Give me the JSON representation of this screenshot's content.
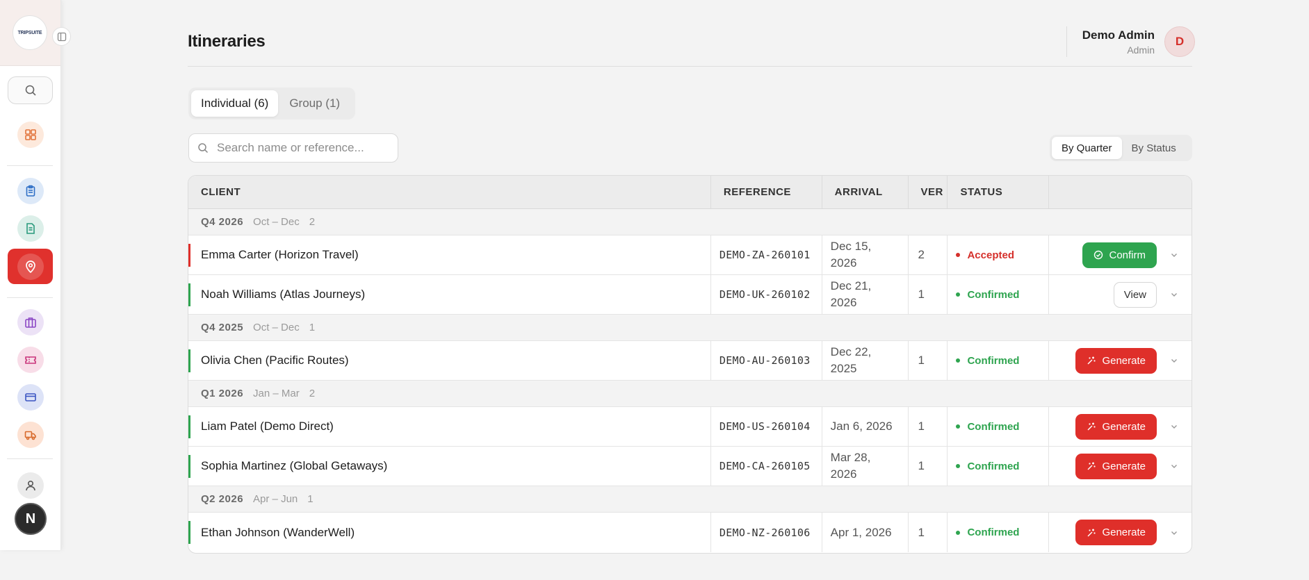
{
  "app": {
    "logo_text": "TRIPSUITE"
  },
  "header": {
    "title": "Itineraries",
    "user_name": "Demo Admin",
    "user_role": "Admin",
    "user_initial": "D"
  },
  "sidebar": {
    "user_initial": "N"
  },
  "tabs": [
    {
      "label": "Individual (6)"
    },
    {
      "label": "Group (1)"
    }
  ],
  "search": {
    "placeholder": "Search name or reference..."
  },
  "view_toggle": [
    {
      "label": "By Quarter"
    },
    {
      "label": "By Status"
    }
  ],
  "table": {
    "columns": [
      "CLIENT",
      "REFERENCE",
      "ARRIVAL",
      "VER",
      "STATUS"
    ],
    "groups": [
      {
        "quarter": "Q4 2026",
        "range": "Oct – Dec",
        "count": "2",
        "rows": [
          {
            "client": "Emma Carter (Horizon Travel)",
            "reference": "DEMO-ZA-260101",
            "arrival_line1": "Dec 15,",
            "arrival_line2": "2026",
            "ver": "2",
            "status": "Accepted",
            "action": "Confirm"
          },
          {
            "client": "Noah Williams (Atlas Journeys)",
            "reference": "DEMO-UK-260102",
            "arrival_line1": "Dec 21,",
            "arrival_line2": "2026",
            "ver": "1",
            "status": "Confirmed",
            "action": "View"
          }
        ]
      },
      {
        "quarter": "Q4 2025",
        "range": "Oct – Dec",
        "count": "1",
        "rows": [
          {
            "client": "Olivia Chen (Pacific Routes)",
            "reference": "DEMO-AU-260103",
            "arrival_line1": "Dec 22,",
            "arrival_line2": "2025",
            "ver": "1",
            "status": "Confirmed",
            "action": "Generate"
          }
        ]
      },
      {
        "quarter": "Q1 2026",
        "range": "Jan – Mar",
        "count": "2",
        "rows": [
          {
            "client": "Liam Patel (Demo Direct)",
            "reference": "DEMO-US-260104",
            "arrival_line1": "Jan 6, 2026",
            "arrival_line2": "",
            "ver": "1",
            "status": "Confirmed",
            "action": "Generate"
          },
          {
            "client": "Sophia Martinez (Global Getaways)",
            "reference": "DEMO-CA-260105",
            "arrival_line1": "Mar 28,",
            "arrival_line2": "2026",
            "ver": "1",
            "status": "Confirmed",
            "action": "Generate"
          }
        ]
      },
      {
        "quarter": "Q2 2026",
        "range": "Apr – Jun",
        "count": "1",
        "rows": [
          {
            "client": "Ethan Johnson (WanderWell)",
            "reference": "DEMO-NZ-260106",
            "arrival_line1": "Apr 1, 2026",
            "arrival_line2": "",
            "ver": "1",
            "status": "Confirmed",
            "action": "Generate"
          }
        ]
      }
    ]
  },
  "colors": {
    "brand_red": "#df2f2a",
    "confirm_green": "#2ea44f",
    "status_accepted": "#d5302b",
    "status_confirmed": "#2ea44f"
  },
  "icons": {
    "sidebar": [
      "search-icon",
      "dashboard-grid-icon",
      "clipboard-icon",
      "document-icon",
      "map-pin-icon",
      "briefcase-icon",
      "ticket-icon",
      "credit-card-icon",
      "truck-icon",
      "user-icon"
    ],
    "actions": [
      "check-circle-icon",
      "sparkle-icon",
      "chevron-down-icon"
    ]
  }
}
